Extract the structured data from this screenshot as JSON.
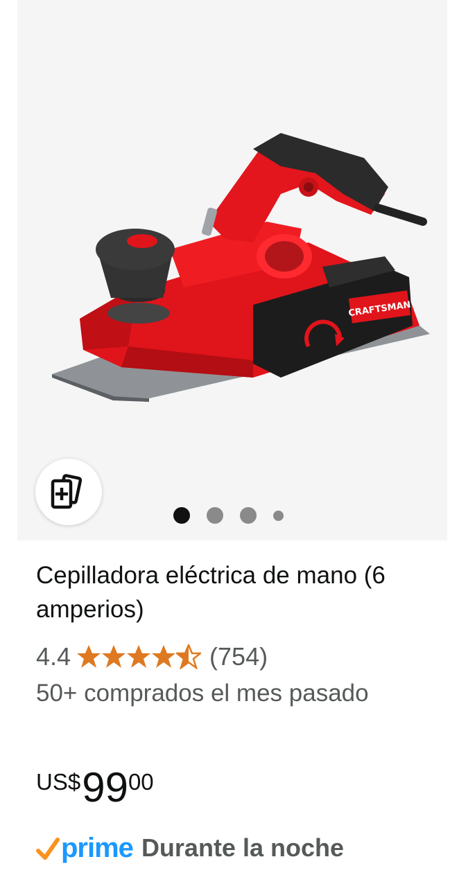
{
  "product": {
    "title": "Cepilladora eléctrica de mano (6 amperios)",
    "image_icon": "craftsman-electric-planer-image",
    "brand_label": "CRAFTSMAN",
    "compare_icon": "add-to-compare-icon",
    "carousel": {
      "count": 4,
      "active_index": 0
    }
  },
  "rating": {
    "value": "4.4",
    "stars": 4.4,
    "star_color": "#de7921",
    "count": "(754)"
  },
  "bought_text": "50+ comprados el mes pasado",
  "price": {
    "symbol": "US$",
    "whole": "99",
    "fraction": "00"
  },
  "delivery": {
    "prime_label": "prime",
    "prime_check_color": "#f7931e",
    "prime_color": "#1a98ff",
    "text": "Durante la noche"
  }
}
